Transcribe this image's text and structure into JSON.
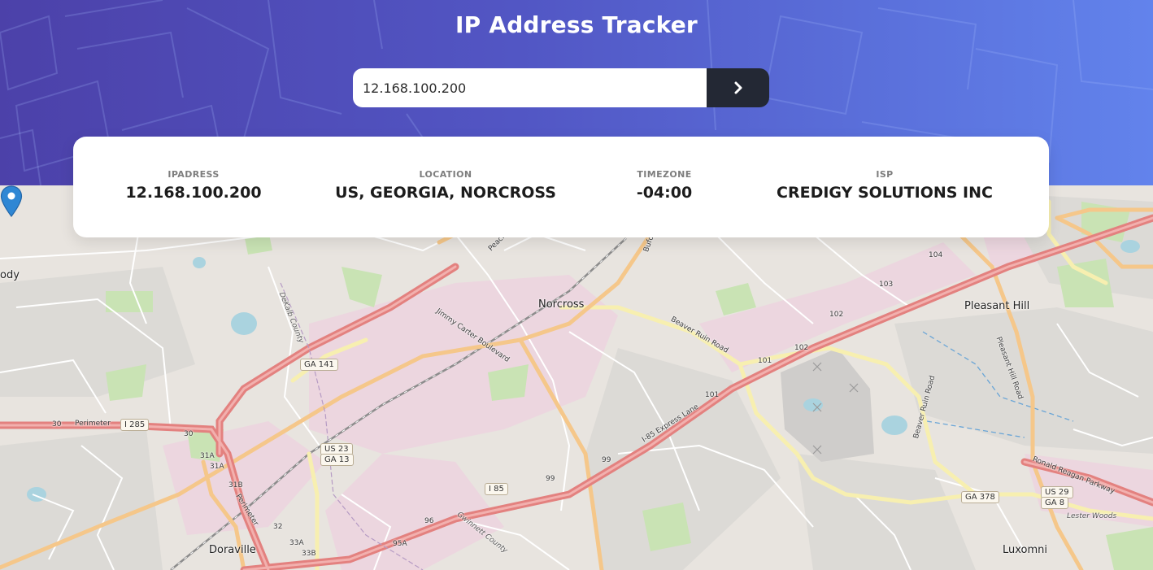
{
  "header": {
    "title": "IP Address Tracker",
    "colors": {
      "gradient_start": "#4c41a9",
      "gradient_end": "#6283ec",
      "button": "#232834"
    }
  },
  "search": {
    "value": "12.168.100.200",
    "placeholder": "",
    "button_icon": "chevron-right-icon"
  },
  "info": {
    "ip": {
      "label": "IPADRESS",
      "value": "12.168.100.200"
    },
    "location": {
      "label": "LOCATION",
      "value": "US, GEORGIA, NORCROSS"
    },
    "timezone": {
      "label": "TIMEZONE",
      "value": "-04:00"
    },
    "isp": {
      "label": "ISP",
      "value": "CREDIGY SOLUTIONS INC"
    }
  },
  "map": {
    "marker_icon": "map-pin-icon",
    "places": {
      "norcross": "Norcross",
      "pleasant_hill": "Pleasant Hill",
      "doraville": "Doraville",
      "luxomni": "Luxomni",
      "ody": "ody",
      "lester_woods": "Lester Woods"
    },
    "roads": {
      "jimmy_carter": "Jimmy Carter Boulevard",
      "beaver_ruin_road": "Beaver Ruin Road",
      "beaver_ruin_road_2": "Beaver Ruin Road",
      "pleasant_hill_road": "Pleasant Hill Road",
      "ronald_reagan": "Ronald Reagan Parkway",
      "i85_express": "I-85 Express Lane",
      "perimeter": "Perimeter",
      "perimeter_2": "Perimeter",
      "peachtree": "Peachtr",
      "buford": "Bufo",
      "dekalb_county": "DeKalb County",
      "gwinnett_county": "Gwinnett County"
    },
    "shields": {
      "ga141": "GA 141",
      "i285": "I 285",
      "us23": "US 23",
      "ga13": "GA 13",
      "i85": "I 85",
      "ga378": "GA 378",
      "us29": "US 29",
      "ga8": "GA 8"
    },
    "exits": {
      "e104": "104",
      "e103": "103",
      "e102a": "102",
      "e102b": "102",
      "e101a": "101",
      "e101b": "101",
      "e99a": "99",
      "e99b": "99",
      "e30a": "30",
      "e30b": "30",
      "e31a": "31A",
      "e31a2": "31A",
      "e31b": "31B",
      "e32": "32",
      "e33a": "33A",
      "e33b": "33B",
      "e96": "96",
      "e95a": "95A"
    }
  }
}
